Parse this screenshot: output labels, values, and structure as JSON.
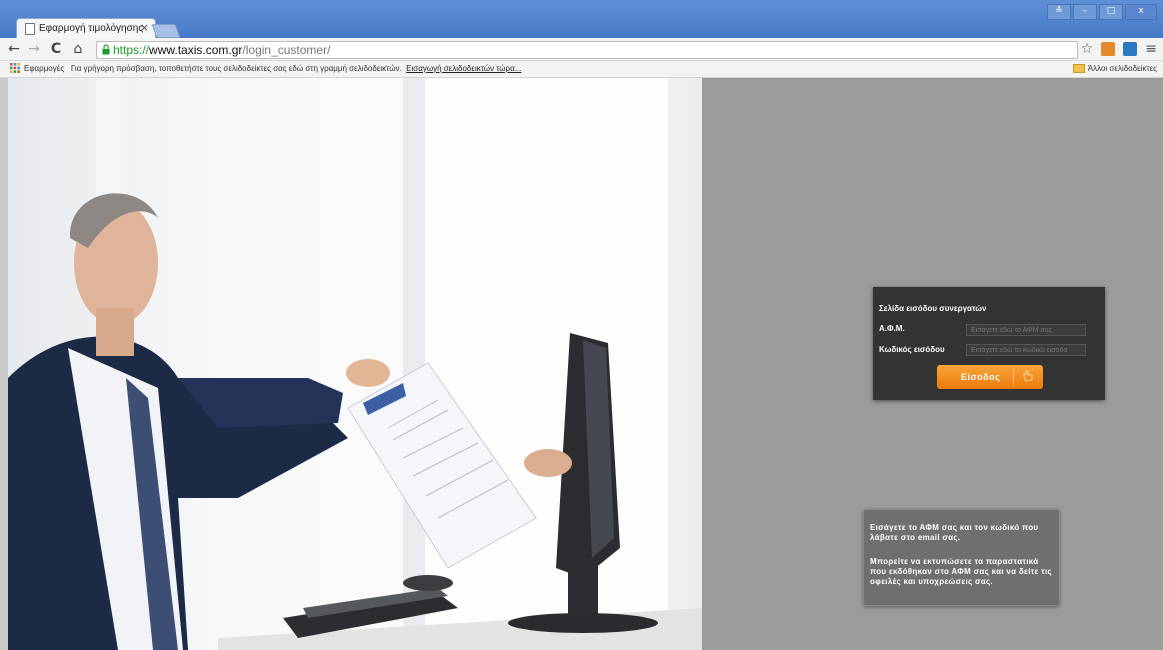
{
  "browser": {
    "tab_title": "Εφαρμογή τιμολόγησης",
    "tab_close": "×",
    "url_scheme": "https://",
    "url_host": "www.taxis.com.gr",
    "url_path": "/login_customer/",
    "window_controls": [
      "≛",
      "–",
      "□",
      "x"
    ]
  },
  "bookmarks": {
    "apps_label": "Εφαρμογές",
    "hint": "Για γρήγορη πρόσβαση, τοποθετήστε τους σελιδοδείκτες σας εδώ στη γραμμή σελιδοδεικτών.",
    "import_link": "Εισαγωγή σελιδοδεικτών τώρα...",
    "other_label": "Άλλοι σελιδοδείκτες"
  },
  "login": {
    "title": "Σελίδα εισόδου συνεργατών",
    "afm_label": "Α.Φ.Μ.",
    "afm_placeholder": "Εισάγετε εδώ το ΑΦΜ σας",
    "code_label": "Κωδικός εισόδου",
    "code_placeholder": "Εισάγετε εδώ το κωδικό εισόδο",
    "button_label": "Είσοδος"
  },
  "info": {
    "paragraph1": "Εισάγετε το ΑΦΜ σας και τον κωδικό που λάβατε στο email σας.",
    "paragraph2": "Μπορείτε να εκτυπώσετε τα παραστατικά που εκδόθηκαν στο ΑΦΜ σας και να δείτε τις οφειλές και υποχρεώσεις σας."
  }
}
